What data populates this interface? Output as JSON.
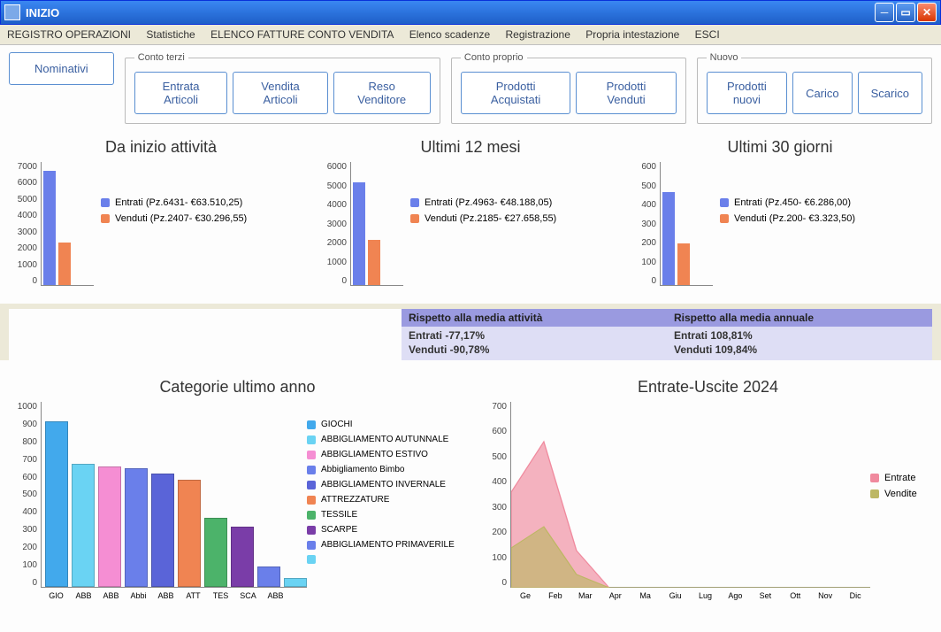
{
  "window": {
    "title": "INIZIO"
  },
  "menu": {
    "items": [
      "REGISTRO OPERAZIONI",
      "Statistiche",
      "ELENCO FATTURE CONTO VENDITA",
      "Elenco scadenze",
      "Registrazione",
      "Propria intestazione",
      "ESCI"
    ]
  },
  "toolbar": {
    "nominativi": "Nominativi",
    "conto_terzi": {
      "legend": "Conto terzi",
      "buttons": [
        "Entrata Articoli",
        "Vendita Articoli",
        "Reso Venditore"
      ]
    },
    "conto_proprio": {
      "legend": "Conto proprio",
      "buttons": [
        "Prodotti Acquistati",
        "Prodotti Venduti"
      ]
    },
    "nuovo": {
      "legend": "Nuovo",
      "buttons": [
        "Prodotti nuovi",
        "Carico",
        "Scarico"
      ]
    }
  },
  "stats": {
    "col1": {
      "header": "Rispetto alla media attività",
      "entrati": "Entrati -77,17%",
      "venduti": "Venduti -90,78%"
    },
    "col2": {
      "header": "Rispetto alla media annuale",
      "entrati": "Entrati 108,81%",
      "venduti": "Venduti 109,84%"
    }
  },
  "palette": {
    "entrati": "#6a7fea",
    "venduti": "#f08452",
    "area_entrate": "#f08a9e",
    "area_vendite": "#bdb764"
  },
  "chart_data": [
    {
      "id": "inizio_attivita",
      "type": "bar",
      "title": "Da inizio attività",
      "categories": [
        "Entrati",
        "Venduti"
      ],
      "values": [
        6431,
        2407
      ],
      "legend": [
        "Entrati (Pz.6431- €63.510,25)",
        "Venduti (Pz.2407- €30.296,55)"
      ],
      "colors": [
        "#6a7fea",
        "#f08452"
      ],
      "ylim": [
        0,
        7000
      ],
      "yticks": [
        0,
        1000,
        2000,
        3000,
        4000,
        5000,
        6000,
        7000
      ]
    },
    {
      "id": "ultimi_12_mesi",
      "type": "bar",
      "title": "Ultimi 12 mesi",
      "categories": [
        "Entrati",
        "Venduti"
      ],
      "values": [
        4963,
        2185
      ],
      "legend": [
        "Entrati (Pz.4963- €48.188,05)",
        "Venduti (Pz.2185- €27.658,55)"
      ],
      "colors": [
        "#6a7fea",
        "#f08452"
      ],
      "ylim": [
        0,
        6000
      ],
      "yticks": [
        0,
        1000,
        2000,
        3000,
        4000,
        5000,
        6000
      ]
    },
    {
      "id": "ultimi_30_giorni",
      "type": "bar",
      "title": "Ultimi 30 giorni",
      "categories": [
        "Entrati",
        "Venduti"
      ],
      "values": [
        450,
        200
      ],
      "legend": [
        "Entrati (Pz.450- €6.286,00)",
        "Venduti (Pz.200- €3.323,50)"
      ],
      "colors": [
        "#6a7fea",
        "#f08452"
      ],
      "ylim": [
        0,
        600
      ],
      "yticks": [
        0,
        100,
        200,
        300,
        400,
        500,
        600
      ]
    },
    {
      "id": "categorie_ultimo_anno",
      "type": "bar",
      "title": "Categorie ultimo anno",
      "categories": [
        "GIO",
        "ABB",
        "ABB",
        "Abbi",
        "ABB",
        "ATT",
        "TES",
        "SCA",
        "ABB"
      ],
      "values": [
        890,
        660,
        650,
        640,
        610,
        575,
        370,
        325,
        110
      ],
      "legend_labels": [
        "GIOCHI",
        "ABBIGLIAMENTO AUTUNNALE",
        "ABBIGLIAMENTO ESTIVO",
        "Abbigliamento Bimbo",
        "ABBIGLIAMENTO INVERNALE",
        "ATTREZZATURE",
        "TESSILE",
        "SCARPE",
        "ABBIGLIAMENTO PRIMAVERILE",
        ""
      ],
      "colors": [
        "#42a9ec",
        "#6ad3f3",
        "#f58ed3",
        "#6a7fea",
        "#5a64d8",
        "#f08452",
        "#4cb36a",
        "#7a3da8",
        "#6a7fea",
        "#6ad3f3"
      ],
      "ylim": [
        0,
        1000
      ],
      "yticks": [
        0,
        100,
        200,
        300,
        400,
        500,
        600,
        700,
        800,
        900,
        1000
      ]
    },
    {
      "id": "entrate_uscite_2024",
      "type": "area",
      "title": "Entrate-Uscite 2024",
      "x": [
        "Ge",
        "Feb",
        "Mar",
        "Apr",
        "Ma",
        "Giu",
        "Lug",
        "Ago",
        "Set",
        "Ott",
        "Nov",
        "Dic"
      ],
      "series": [
        {
          "name": "Entrate",
          "values": [
            360,
            550,
            140,
            0,
            0,
            0,
            0,
            0,
            0,
            0,
            0,
            0
          ],
          "color": "#f08a9e"
        },
        {
          "name": "Vendite",
          "values": [
            150,
            230,
            50,
            0,
            0,
            0,
            0,
            0,
            0,
            0,
            0,
            0
          ],
          "color": "#bdb764"
        }
      ],
      "ylim": [
        0,
        700
      ],
      "yticks": [
        0,
        100,
        200,
        300,
        400,
        500,
        600,
        700
      ]
    }
  ]
}
